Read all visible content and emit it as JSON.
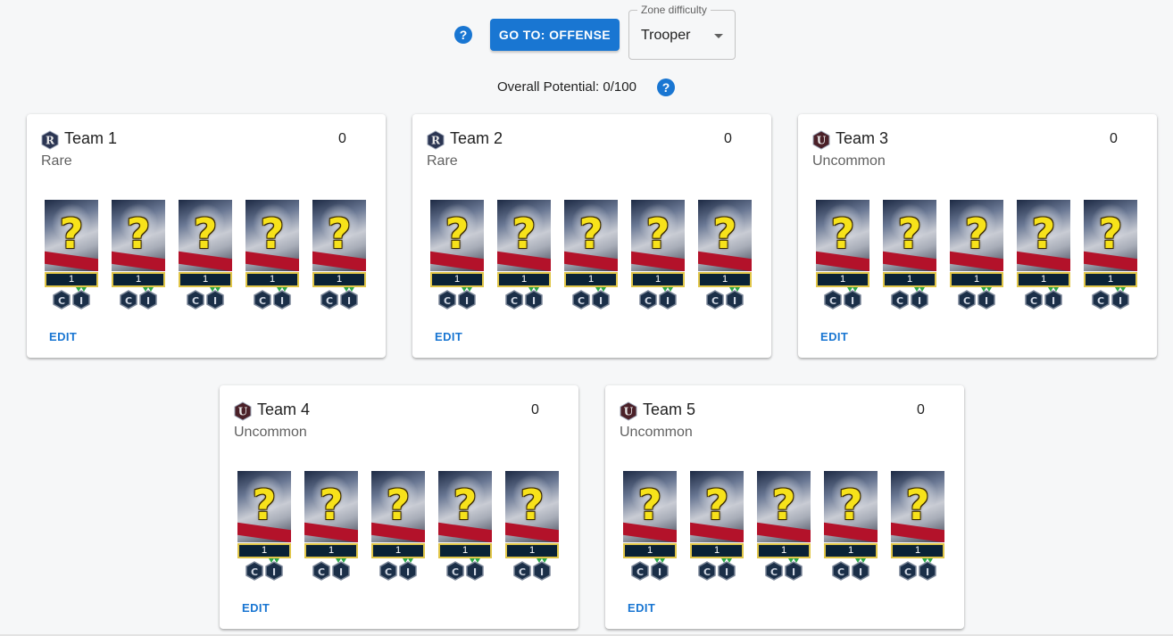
{
  "header": {
    "help_icon": "question-circle-icon",
    "goto_label": "GO TO: OFFENSE",
    "zone_difficulty_label": "Zone difficulty",
    "zone_difficulty_value": "Trooper",
    "overall_potential": "Overall Potential: 0/100",
    "accent_color": "#1976d2"
  },
  "teams": [
    {
      "name": "Team 1",
      "rarity": "Rare",
      "score": "0",
      "badge_letter": "R",
      "badge_color": "#2b3552",
      "edit": "EDIT",
      "units": [
        {
          "level": "1"
        },
        {
          "level": "1"
        },
        {
          "level": "1"
        },
        {
          "level": "1"
        },
        {
          "level": "1"
        }
      ]
    },
    {
      "name": "Team 2",
      "rarity": "Rare",
      "score": "0",
      "badge_letter": "R",
      "badge_color": "#2b3552",
      "edit": "EDIT",
      "units": [
        {
          "level": "1"
        },
        {
          "level": "1"
        },
        {
          "level": "1"
        },
        {
          "level": "1"
        },
        {
          "level": "1"
        }
      ]
    },
    {
      "name": "Team 3",
      "rarity": "Uncommon",
      "score": "0",
      "badge_letter": "U",
      "badge_color": "#4a2028",
      "edit": "EDIT",
      "units": [
        {
          "level": "1"
        },
        {
          "level": "1"
        },
        {
          "level": "1"
        },
        {
          "level": "1"
        },
        {
          "level": "1"
        }
      ]
    },
    {
      "name": "Team 4",
      "rarity": "Uncommon",
      "score": "0",
      "badge_letter": "U",
      "badge_color": "#4a2028",
      "edit": "EDIT",
      "units": [
        {
          "level": "1"
        },
        {
          "level": "1"
        },
        {
          "level": "1"
        },
        {
          "level": "1"
        },
        {
          "level": "1"
        }
      ]
    },
    {
      "name": "Team 5",
      "rarity": "Uncommon",
      "score": "0",
      "badge_letter": "U",
      "badge_color": "#4a2028",
      "edit": "EDIT",
      "units": [
        {
          "level": "1"
        },
        {
          "level": "1"
        },
        {
          "level": "1"
        },
        {
          "level": "1"
        },
        {
          "level": "1"
        }
      ]
    }
  ],
  "unit_icons": {
    "portrait": "unknown-character-question-icon",
    "gear_left": "c-gear-hex-icon",
    "gear_right": "i-gear-hex-icon",
    "gear_left_letter": "C",
    "gear_right_letter": "I"
  }
}
